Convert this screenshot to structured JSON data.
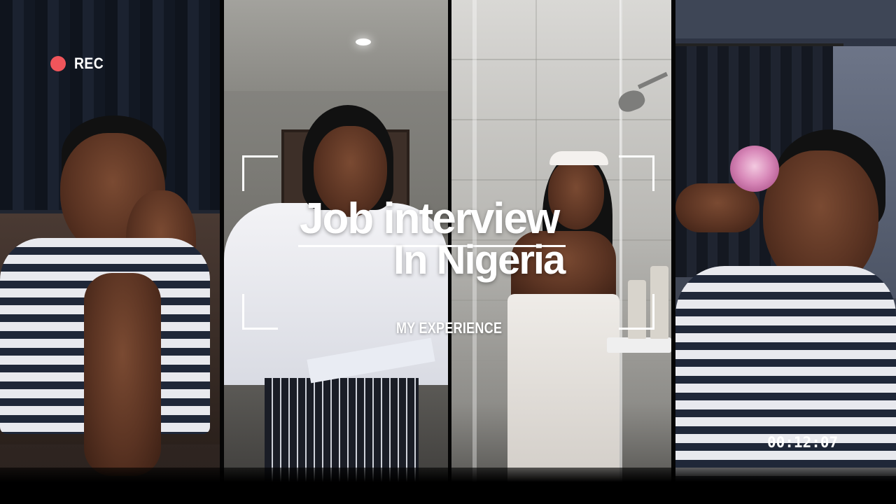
{
  "recording": {
    "indicator_label": "REC",
    "indicator_color": "#f0555b"
  },
  "title": {
    "line1": "Job interview",
    "line2": "In Nigeria"
  },
  "subtitle": "MY EXPERIENCE",
  "timecode": "00:12:07",
  "panels": [
    {
      "scene": "woman in striped top resting chin on hand"
    },
    {
      "scene": "woman in white shirt holding papers"
    },
    {
      "scene": "woman in towel in shower"
    },
    {
      "scene": "woman with pink rose in hair"
    }
  ],
  "colors": {
    "text": "#ffffff",
    "frame_corners": "#ffffff"
  }
}
